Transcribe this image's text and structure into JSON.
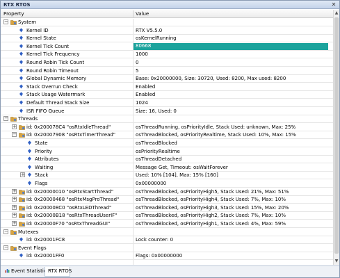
{
  "window": {
    "title": "RTX RTOS",
    "close_glyph": "✕"
  },
  "header": {
    "col_property": "Property",
    "col_value": "Value"
  },
  "rows": [
    {
      "level": 0,
      "exp": "−",
      "icon": "folder",
      "name": "System",
      "value": ""
    },
    {
      "level": 1,
      "exp": "",
      "icon": "prop",
      "name": "Kernel ID",
      "value": "RTX V5.5.0"
    },
    {
      "level": 1,
      "exp": "",
      "icon": "prop",
      "name": "Kernel State",
      "value": "osKernelRunning"
    },
    {
      "level": 1,
      "exp": "",
      "icon": "prop",
      "name": "Kernel Tick Count",
      "value": "80668",
      "highlight": true
    },
    {
      "level": 1,
      "exp": "",
      "icon": "prop",
      "name": "Kernel Tick Frequency",
      "value": "1000"
    },
    {
      "level": 1,
      "exp": "",
      "icon": "prop",
      "name": "Round Robin Tick Count",
      "value": "0"
    },
    {
      "level": 1,
      "exp": "",
      "icon": "prop",
      "name": "Round Robin Timeout",
      "value": "5"
    },
    {
      "level": 1,
      "exp": "",
      "icon": "prop",
      "name": "Global Dynamic Memory",
      "value": "Base: 0x20000000, Size: 30720, Used: 8200, Max used: 8200"
    },
    {
      "level": 1,
      "exp": "",
      "icon": "prop",
      "name": "Stack Overrun Check",
      "value": "Enabled"
    },
    {
      "level": 1,
      "exp": "",
      "icon": "prop",
      "name": "Stack Usage Watermark",
      "value": "Enabled"
    },
    {
      "level": 1,
      "exp": "",
      "icon": "prop",
      "name": "Default Thread Stack Size",
      "value": "1024"
    },
    {
      "level": 1,
      "exp": "",
      "icon": "prop",
      "name": "ISR FIFO Queue",
      "value": "Size: 16, Used: 0"
    },
    {
      "level": 0,
      "exp": "−",
      "icon": "folder",
      "name": "Threads",
      "value": ""
    },
    {
      "level": 1,
      "exp": "+",
      "icon": "folder",
      "name": "id: 0x200078C4 \"osRtxIdleThread\"",
      "value": "osThreadRunning, osPriorityIdle, Stack Used: unknown, Max: 25%"
    },
    {
      "level": 1,
      "exp": "−",
      "icon": "folder",
      "name": "id: 0x20007908 \"osRtxTimerThread\"",
      "value": "osThreadBlocked, osPriorityRealtime, Stack Used: 10%, Max: 15%"
    },
    {
      "level": 2,
      "exp": "",
      "icon": "prop",
      "name": "State",
      "value": "osThreadBlocked"
    },
    {
      "level": 2,
      "exp": "",
      "icon": "prop",
      "name": "Priority",
      "value": "osPriorityRealtime"
    },
    {
      "level": 2,
      "exp": "",
      "icon": "prop",
      "name": "Attributes",
      "value": "osThreadDetached"
    },
    {
      "level": 2,
      "exp": "",
      "icon": "prop",
      "name": "Waiting",
      "value": "Message Get, Timeout: osWaitForever"
    },
    {
      "level": 2,
      "exp": "+",
      "icon": "prop",
      "name": "Stack",
      "value": "Used: 10% [104], Max: 15% [160]"
    },
    {
      "level": 2,
      "exp": "",
      "icon": "prop",
      "name": "Flags",
      "value": "0x00000000"
    },
    {
      "level": 1,
      "exp": "+",
      "icon": "folder",
      "name": "id: 0x20000010 \"osRtxStartThread\"",
      "value": "osThreadBlocked, osPriorityHigh5, Stack Used: 21%, Max: 51%"
    },
    {
      "level": 1,
      "exp": "+",
      "icon": "folder",
      "name": "id: 0x20000468 \"osRtxMsgProThread\"",
      "value": "osThreadBlocked, osPriorityHigh4, Stack Used: 7%, Max: 10%"
    },
    {
      "level": 1,
      "exp": "+",
      "icon": "folder",
      "name": "id: 0x200008C0 \"osRtxLEDThread\"",
      "value": "osThreadBlocked, osPriorityHigh3, Stack Used: 15%, Max: 20%"
    },
    {
      "level": 1,
      "exp": "+",
      "icon": "folder",
      "name": "id: 0x20000B18 \"osRtxThreadUserIF\"",
      "value": "osThreadBlocked, osPriorityHigh2, Stack Used: 7%, Max: 10%"
    },
    {
      "level": 1,
      "exp": "+",
      "icon": "folder",
      "name": "id: 0x20000F70 \"osRtxThreadGUI\"",
      "value": "osThreadBlocked, osPriorityHigh1, Stack Used: 4%, Max: 59%"
    },
    {
      "level": 0,
      "exp": "−",
      "icon": "folder",
      "name": "Mutexes",
      "value": ""
    },
    {
      "level": 1,
      "exp": "",
      "icon": "prop",
      "name": "id: 0x20001FC8",
      "value": "Lock counter: 0"
    },
    {
      "level": 0,
      "exp": "−",
      "icon": "folder",
      "name": "Event Flags",
      "value": ""
    },
    {
      "level": 1,
      "exp": "",
      "icon": "prop",
      "name": "id: 0x20001FF0",
      "value": "Flags: 0x00000000"
    }
  ],
  "tabs": [
    {
      "label": "Event Statistics",
      "active": false
    },
    {
      "label": "RTX RTOS",
      "active": true
    }
  ],
  "colors": {
    "highlight": "#1ba39c",
    "prop_icon": "#2f5fc4",
    "folder_icon": "#d9a441"
  }
}
